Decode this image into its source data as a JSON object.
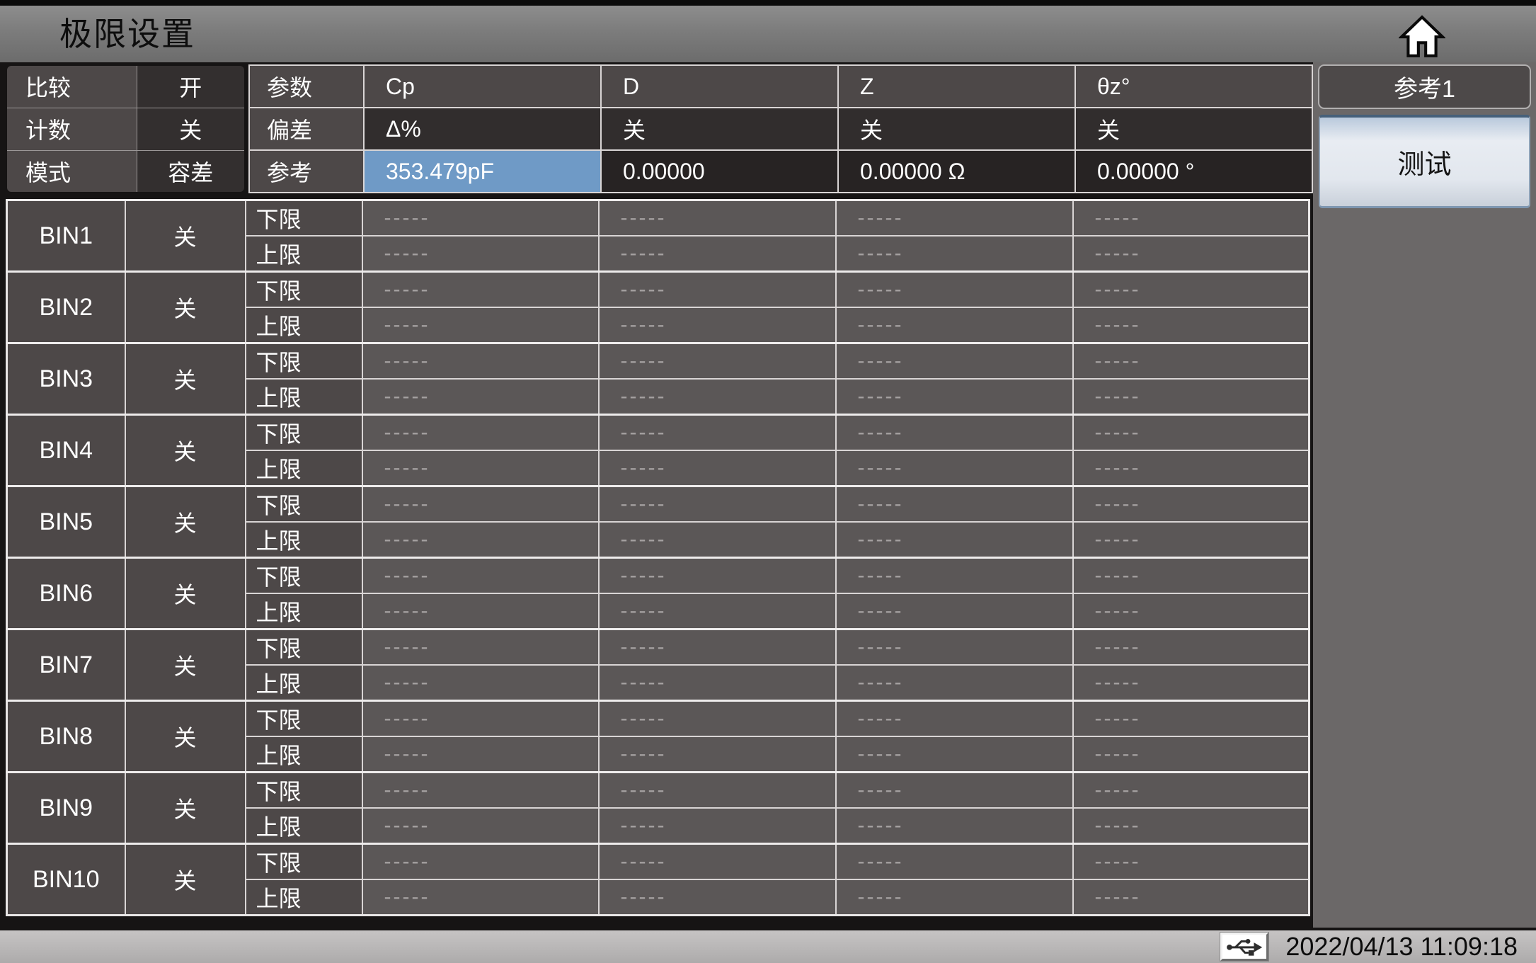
{
  "title_bar": {
    "title": "极限设置"
  },
  "settings_panel": {
    "rows": [
      {
        "label": "比较",
        "value": "开"
      },
      {
        "label": "计数",
        "value": "关"
      },
      {
        "label": "模式",
        "value": "容差"
      }
    ]
  },
  "param_table": {
    "rows": [
      {
        "label": "参数",
        "values": [
          "Cp",
          "D",
          "Z",
          "θz°"
        ]
      },
      {
        "label": "偏差",
        "values": [
          "Δ%",
          "关",
          "关",
          "关"
        ]
      },
      {
        "label": "参考",
        "values": [
          "353.479pF",
          "0.00000",
          "0.00000 Ω",
          "0.00000 °"
        ],
        "highlighted_value": "353.479pF"
      }
    ]
  },
  "bin_table": {
    "lower_label": "下限",
    "upper_label": "上限",
    "bins": [
      {
        "name": "BIN1",
        "state": "关",
        "lower": [
          "-----",
          "-----",
          "-----",
          "-----"
        ],
        "upper": [
          "-----",
          "-----",
          "-----",
          "-----"
        ]
      },
      {
        "name": "BIN2",
        "state": "关",
        "lower": [
          "-----",
          "-----",
          "-----",
          "-----"
        ],
        "upper": [
          "-----",
          "-----",
          "-----",
          "-----"
        ]
      },
      {
        "name": "BIN3",
        "state": "关",
        "lower": [
          "-----",
          "-----",
          "-----",
          "-----"
        ],
        "upper": [
          "-----",
          "-----",
          "-----",
          "-----"
        ]
      },
      {
        "name": "BIN4",
        "state": "关",
        "lower": [
          "-----",
          "-----",
          "-----",
          "-----"
        ],
        "upper": [
          "-----",
          "-----",
          "-----",
          "-----"
        ]
      },
      {
        "name": "BIN5",
        "state": "关",
        "lower": [
          "-----",
          "-----",
          "-----",
          "-----"
        ],
        "upper": [
          "-----",
          "-----",
          "-----",
          "-----"
        ]
      },
      {
        "name": "BIN6",
        "state": "关",
        "lower": [
          "-----",
          "-----",
          "-----",
          "-----"
        ],
        "upper": [
          "-----",
          "-----",
          "-----",
          "-----"
        ]
      },
      {
        "name": "BIN7",
        "state": "关",
        "lower": [
          "-----",
          "-----",
          "-----",
          "-----"
        ],
        "upper": [
          "-----",
          "-----",
          "-----",
          "-----"
        ]
      },
      {
        "name": "BIN8",
        "state": "关",
        "lower": [
          "-----",
          "-----",
          "-----",
          "-----"
        ],
        "upper": [
          "-----",
          "-----",
          "-----",
          "-----"
        ]
      },
      {
        "name": "BIN9",
        "state": "关",
        "lower": [
          "-----",
          "-----",
          "-----",
          "-----"
        ],
        "upper": [
          "-----",
          "-----",
          "-----",
          "-----"
        ]
      },
      {
        "name": "BIN10",
        "state": "关",
        "lower": [
          "-----",
          "-----",
          "-----",
          "-----"
        ],
        "upper": [
          "-----",
          "-----",
          "-----",
          "-----"
        ]
      }
    ]
  },
  "side_panel": {
    "reference_button": "参考1",
    "test_button": "测试"
  },
  "status_bar": {
    "datetime": "2022/04/13 11:09:18"
  },
  "icons": {
    "home": "home-icon",
    "usb": "usb-icon"
  },
  "colors": {
    "highlight_blue": "#6f9ac6",
    "label_cell_bg": "#4d4848",
    "value_cell_bg": "#5b5757",
    "deviation_cell_bg": "#312d2d",
    "reference_cell_bg": "#272323",
    "right_panel_bg": "#6b6868",
    "title_bar_bg": "#7c7c7c",
    "status_bar_bg": "#b5b3b3"
  }
}
